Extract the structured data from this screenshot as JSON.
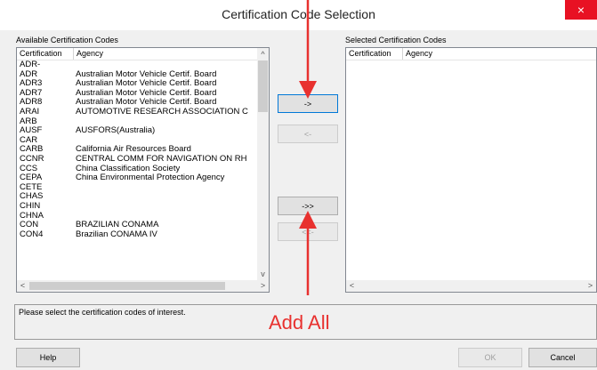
{
  "window": {
    "title": "Certification Code Selection",
    "close_label": "×"
  },
  "available": {
    "label": "Available Certification Codes",
    "columns": [
      "Certification",
      "Agency"
    ],
    "rows": [
      [
        "ADR-",
        ""
      ],
      [
        "ADR",
        "Australian Motor Vehicle Certif. Board"
      ],
      [
        "ADR3",
        "Australian Motor Vehicle Certif. Board"
      ],
      [
        "ADR7",
        "Australian Motor Vehicle Certif. Board"
      ],
      [
        "ADR8",
        "Australian Motor Vehicle Certif. Board"
      ],
      [
        "ARAI",
        "AUTOMOTIVE RESEARCH ASSOCIATION C"
      ],
      [
        "ARB",
        ""
      ],
      [
        "AUSF",
        "AUSFORS(Australia)"
      ],
      [
        "CAR",
        ""
      ],
      [
        "CARB",
        "California Air Resources Board"
      ],
      [
        "CCNR",
        "CENTRAL COMM FOR NAVIGATION ON RH"
      ],
      [
        "CCS",
        "China Classification Society"
      ],
      [
        "CEPA",
        "China Environmental Protection Agency"
      ],
      [
        "CETE",
        ""
      ],
      [
        "CHAS",
        ""
      ],
      [
        "CHIN",
        ""
      ],
      [
        "CHNA",
        ""
      ],
      [
        "CON",
        "BRAZILIAN CONAMA"
      ],
      [
        "CON4",
        "Brazilian CONAMA IV"
      ]
    ]
  },
  "selected": {
    "label": "Selected Certification Codes",
    "columns": [
      "Certification",
      "Agency"
    ]
  },
  "buttons": {
    "add": "->",
    "remove": "<-",
    "add_all": "->>",
    "remove_all": "<<-",
    "help": "Help",
    "ok": "OK",
    "cancel": "Cancel"
  },
  "status_message": "Please select the certification codes of interest.",
  "annotation": {
    "text": "Add All",
    "color": "#e8312f"
  },
  "scroll_arrows": {
    "up": "^",
    "down": "v",
    "left": "<",
    "right": ">"
  }
}
